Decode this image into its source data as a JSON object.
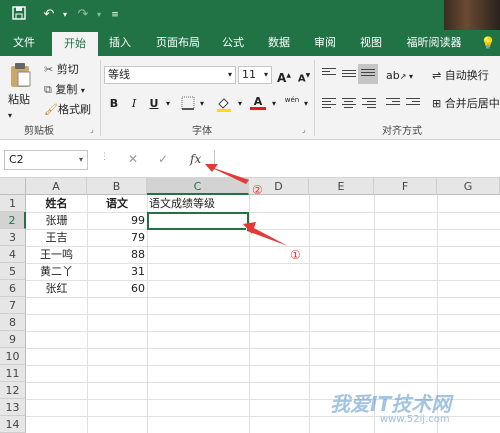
{
  "quick_access": {
    "undo_icon": "undo-icon",
    "redo_icon": "redo-icon"
  },
  "tabs": [
    {
      "label": "文件"
    },
    {
      "label": "开始"
    },
    {
      "label": "插入"
    },
    {
      "label": "页面布局"
    },
    {
      "label": "公式"
    },
    {
      "label": "数据"
    },
    {
      "label": "审阅"
    },
    {
      "label": "视图"
    },
    {
      "label": "福昕阅读器"
    }
  ],
  "ribbon": {
    "clipboard": {
      "paste": "粘贴",
      "cut": "剪切",
      "copy": "复制",
      "format_painter": "格式刷",
      "group": "剪贴板"
    },
    "font": {
      "name": "等线",
      "size": "11",
      "grow": "A",
      "shrink": "A",
      "bold": "B",
      "italic": "I",
      "underline": "U",
      "font_color_letter": "A",
      "wen": "wén",
      "group": "字体"
    },
    "alignment": {
      "wrap_text": "自动换行",
      "merge_center": "合并后居中",
      "group": "对齐方式"
    }
  },
  "formula_bar": {
    "name_box": "C2",
    "cancel": "✕",
    "enter": "✓",
    "fx": "fx",
    "content": ""
  },
  "grid": {
    "columns": [
      "A",
      "B",
      "C",
      "D",
      "E",
      "F",
      "G"
    ],
    "rows": [
      "1",
      "2",
      "3",
      "4",
      "5",
      "6",
      "7",
      "8",
      "9",
      "10",
      "11",
      "12",
      "13",
      "14"
    ],
    "cells": {
      "A1": "姓名",
      "B1": "语文",
      "C1": "语文成绩等级",
      "A2": "张珊",
      "B2": "99",
      "A3": "王吉",
      "B3": "79",
      "A4": "王一鸣",
      "B4": "88",
      "A5": "黄二丫",
      "B5": "31",
      "A6": "张红",
      "B6": "60"
    }
  },
  "annotations": {
    "circle_1": "①",
    "circle_2": "②"
  },
  "watermark": {
    "text": "我爱IT技术网",
    "url": "www.52ij.com"
  },
  "colors": {
    "accent": "#217346",
    "arrow": "#e53935",
    "annotation": "#e53935"
  }
}
